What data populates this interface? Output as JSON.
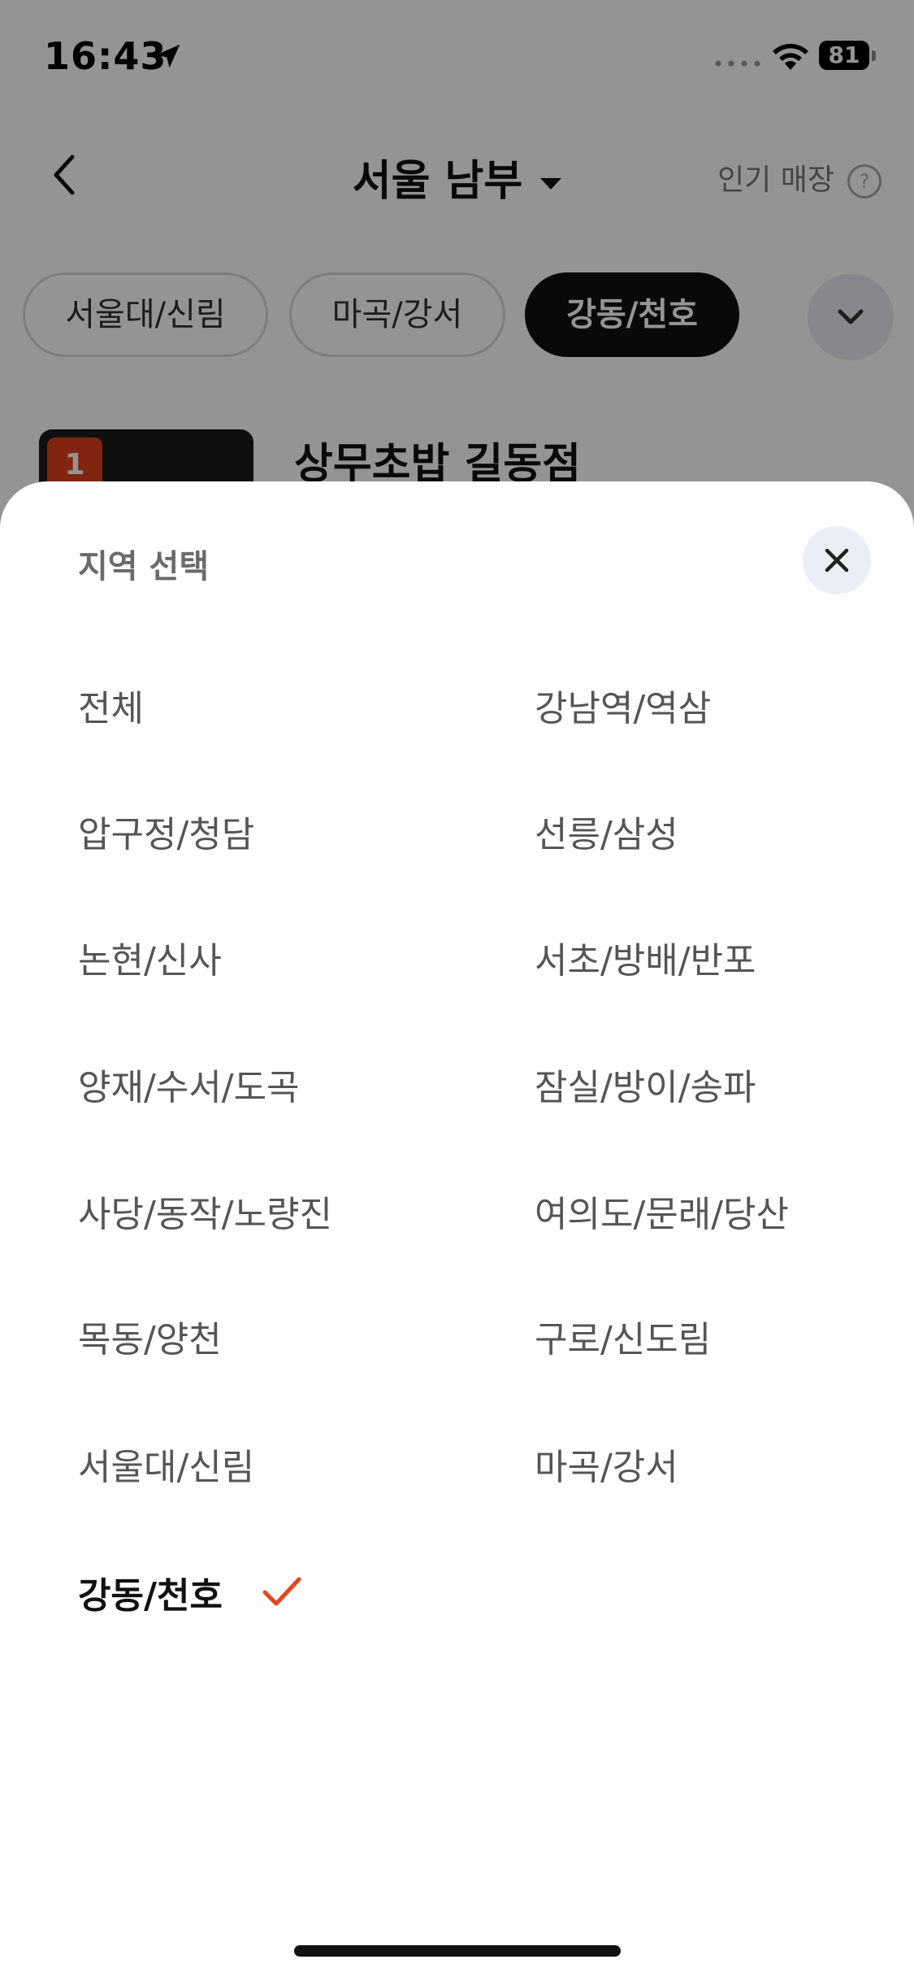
{
  "status_bar": {
    "time": "16:43",
    "battery": "81"
  },
  "nav": {
    "title": "서울 남부",
    "popular_link": "인기 매장",
    "help_glyph": "?"
  },
  "chips": {
    "items": [
      {
        "label": "서울대/신림",
        "active": false
      },
      {
        "label": "마곡/강서",
        "active": false
      },
      {
        "label": "강동/천호",
        "active": true
      }
    ]
  },
  "store_preview": {
    "rank": "1",
    "name": "상무초밥 길동점"
  },
  "sheet": {
    "title": "지역 선택",
    "regions": [
      {
        "label": "전체",
        "selected": false
      },
      {
        "label": "강남역/역삼",
        "selected": false
      },
      {
        "label": "압구정/청담",
        "selected": false
      },
      {
        "label": "선릉/삼성",
        "selected": false
      },
      {
        "label": "논현/신사",
        "selected": false
      },
      {
        "label": "서초/방배/반포",
        "selected": false
      },
      {
        "label": "양재/수서/도곡",
        "selected": false
      },
      {
        "label": "잠실/방이/송파",
        "selected": false
      },
      {
        "label": "사당/동작/노량진",
        "selected": false
      },
      {
        "label": "여의도/문래/당산",
        "selected": false
      },
      {
        "label": "목동/양천",
        "selected": false
      },
      {
        "label": "구로/신도림",
        "selected": false
      },
      {
        "label": "서울대/신림",
        "selected": false
      },
      {
        "label": "마곡/강서",
        "selected": false
      },
      {
        "label": "강동/천호",
        "selected": true
      }
    ]
  },
  "colors": {
    "accent_check": "#e8431f",
    "rank_badge": "#e0401d",
    "active_chip": "#111111",
    "close_button_bg": "#e9eef7"
  },
  "icons": [
    "location-arrow-icon",
    "wifi-icon",
    "battery-icon",
    "back-chevron-icon",
    "caret-down-icon",
    "help-icon",
    "chevron-down-icon",
    "close-icon",
    "check-icon"
  ]
}
